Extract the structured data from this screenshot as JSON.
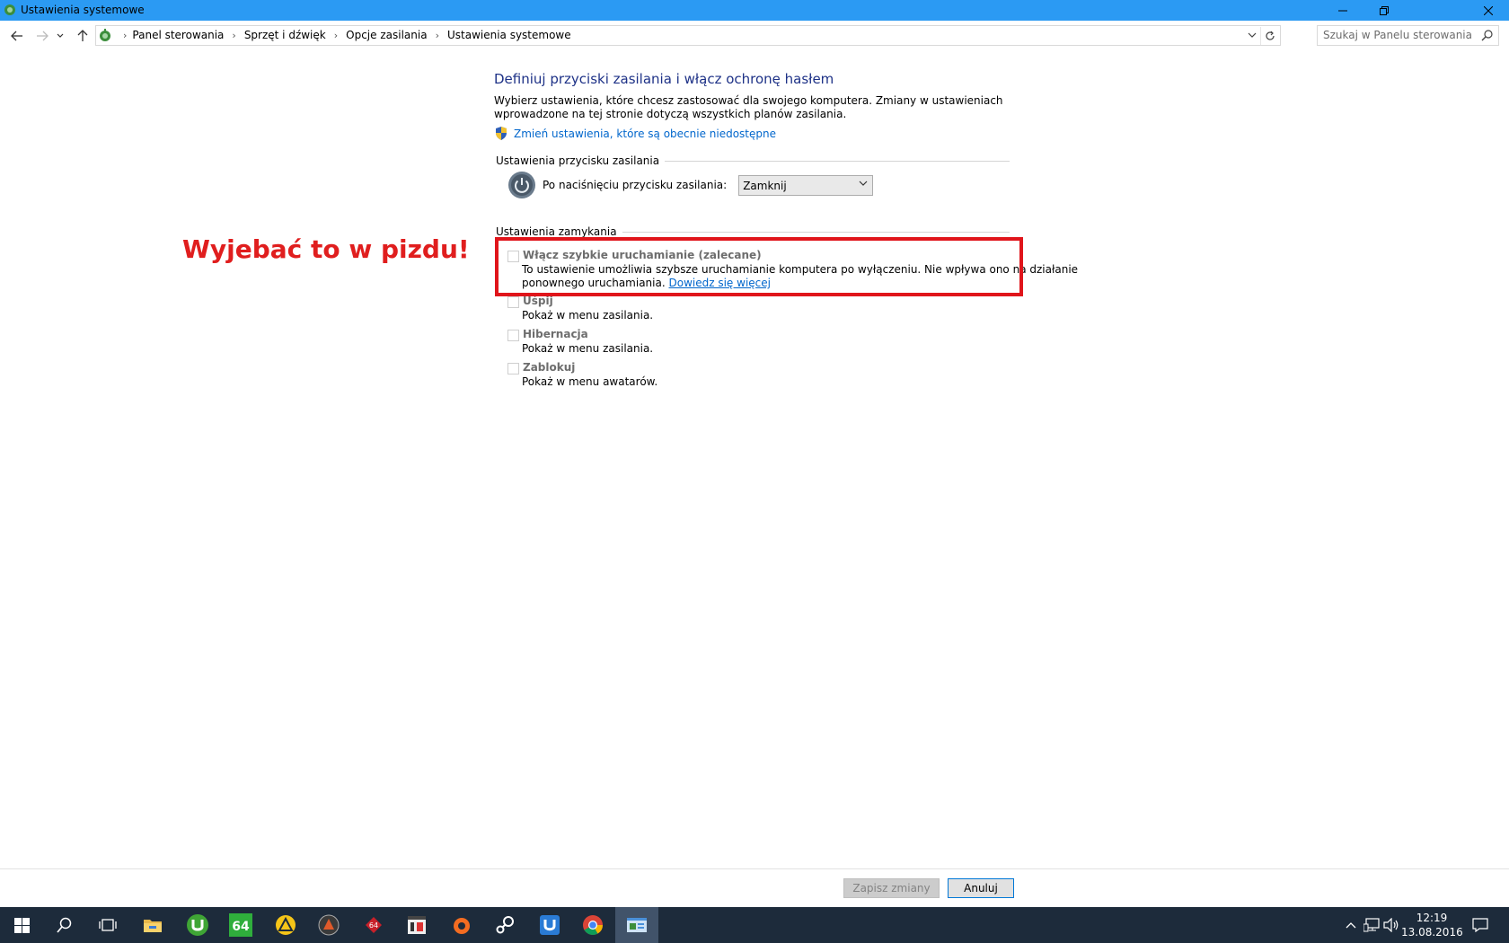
{
  "window": {
    "title": "Ustawienia systemowe",
    "minimize_icon": "minimize-icon",
    "restore_icon": "restore-icon",
    "close_icon": "close-icon"
  },
  "address": {
    "crumbs": [
      "Panel sterowania",
      "Sprzęt i dźwięk",
      "Opcje zasilania",
      "Ustawienia systemowe"
    ],
    "search_placeholder": "Szukaj w Panelu sterowania"
  },
  "main": {
    "heading": "Definiuj przyciski zasilania i włącz ochronę hasłem",
    "description": "Wybierz ustawienia, które chcesz zastosować dla swojego komputera. Zmiany w ustawieniach wprowadzone na tej stronie dotyczą wszystkich planów zasilania.",
    "change_link": "Zmień ustawienia, które są obecnie niedostępne",
    "power_group_title": "Ustawienia przycisku zasilania",
    "power_label": "Po naciśnięciu przycisku zasilania:",
    "power_value": "Zamknij",
    "shutdown_group_title": "Ustawienia zamykania",
    "options": [
      {
        "title": "Włącz szybkie uruchamianie (zalecane)",
        "desc_line1": "To ustawienie umożliwia szybsze uruchamianie komputera po wyłączeniu. Nie wpływa ono na działanie",
        "desc_line2": "ponownego uruchamiania.",
        "more": "Dowiedz się więcej",
        "checked": false
      },
      {
        "title": "Uśpij",
        "desc": "Pokaż w menu zasilania.",
        "checked": false
      },
      {
        "title": "Hibernacja",
        "desc": "Pokaż w menu zasilania.",
        "checked": false
      },
      {
        "title": "Zablokuj",
        "desc": "Pokaż w menu awatarów.",
        "checked": false
      }
    ],
    "annotation": "Wyjebać to w pizdu!",
    "annotation_color": "#e01e1e"
  },
  "footer": {
    "save_label": "Zapisz zmiany",
    "cancel_label": "Anuluj"
  },
  "taskbar": {
    "apps": [
      "start-icon",
      "search-icon",
      "task-view-icon",
      "file-explorer-icon",
      "utorrent-icon",
      "aida64-icon",
      "app-triangle-icon",
      "app-round-icon",
      "app-red-icon",
      "media-icon",
      "origin-icon",
      "steam-icon",
      "uplay-icon",
      "chrome-icon",
      "control-panel-icon"
    ],
    "aida_label": "64",
    "time": "12:19",
    "date": "13.08.2016"
  },
  "colors": {
    "titlebar": "#2b9af3",
    "link": "#0066cc",
    "heading": "#1e3287",
    "taskbar": "#1d2b3b"
  }
}
